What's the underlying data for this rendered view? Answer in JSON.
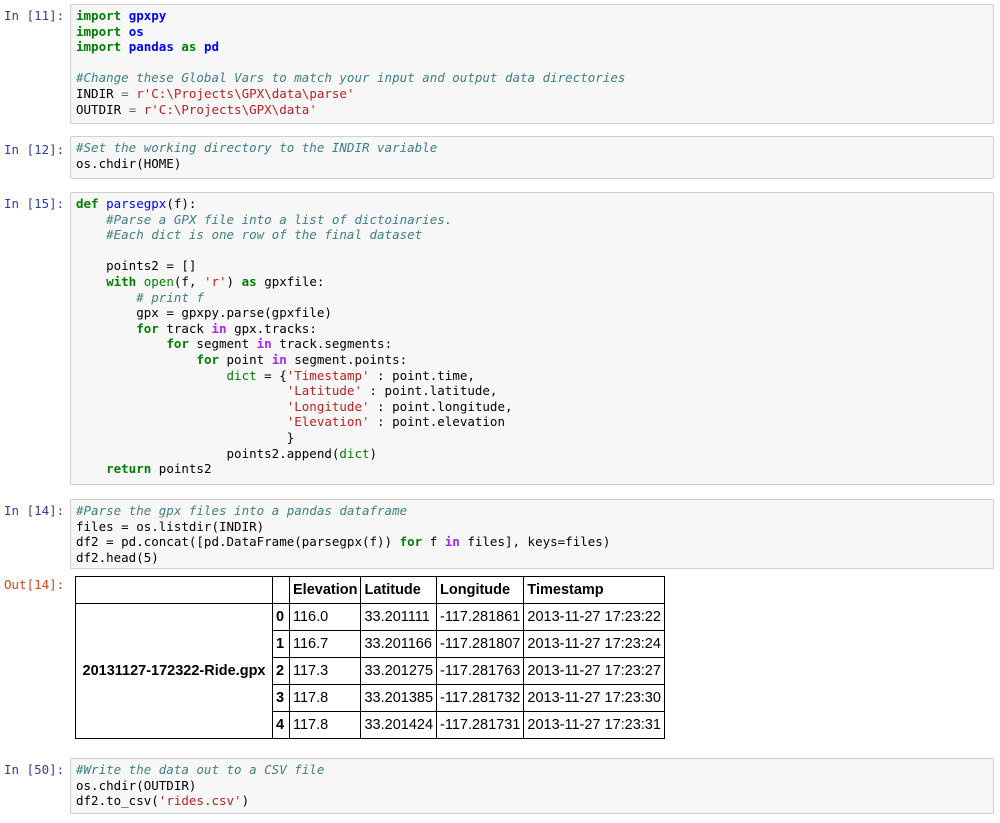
{
  "prompts": {
    "cell1": "In [11]:",
    "cell2": "In [12]:",
    "cell3": "In [15]:",
    "cell4": "In [14]:",
    "out4": "Out[14]:",
    "cell5": "In [50]:"
  },
  "cell1": {
    "kw_import": "import",
    "mod_gpxpy": "gpxpy",
    "mod_os": "os",
    "mod_pandas": "pandas",
    "kw_as": "as",
    "alias_pd": "pd",
    "comment": "#Change these Global Vars to match your input and output data directories",
    "var_indir": "INDIR",
    "var_outdir": "OUTDIR",
    "eq": "=",
    "indir_value": "r'C:\\Projects\\GPX\\data\\parse'",
    "outdir_value": "r'C:\\Projects\\GPX\\data'"
  },
  "cell2": {
    "comment": "#Set the working directory to the INDIR variable",
    "code": "os.chdir(HOME)"
  },
  "cell3": {
    "kw_def": "def",
    "fn_name": "parsegpx",
    "def_args": "(f):",
    "comment1": "#Parse a GPX file into a list of dictoinaries.",
    "comment2": "#Each dict is one row of the final dataset",
    "points_init": "points2 = []",
    "kw_with": "with",
    "open_builtin": "open",
    "open_args_a": "(f, ",
    "str_r": "'r'",
    "open_args_b": ") ",
    "kw_as": "as",
    "with_tail": " gpxfile:",
    "comment3": "# print f",
    "gpx_parse": "gpx = gpxpy.parse(gpxfile)",
    "kw_for": "for",
    "kw_in": "in",
    "loop1_var": " track ",
    "loop1_iter": " gpx.tracks:",
    "loop2_var": " segment ",
    "loop2_iter": " track.segments:",
    "loop3_var": " point ",
    "loop3_iter": " segment.points:",
    "dict_builtin": "dict",
    "dict_assign": " = {",
    "key_timestamp": "'Timestamp'",
    "val_timestamp": " : point.time,",
    "key_latitude": "'Latitude'",
    "val_latitude": " : point.latitude,",
    "key_longitude": "'Longitude'",
    "val_longitude": " : point.longitude,",
    "key_elevation": "'Elevation'",
    "val_elevation": " : point.elevation",
    "dict_close": "}",
    "append_a": "points2.append(",
    "append_b": ")",
    "kw_return": "return",
    "return_val": " points2"
  },
  "cell4": {
    "comment": "#Parse the gpx files into a pandas dataframe",
    "line2": "files = os.listdir(INDIR)",
    "line3_a": "df2 = pd.concat([pd.DataFrame(parsegpx(f)) ",
    "kw_for": "for",
    "line3_b": " f ",
    "kw_in": "in",
    "line3_c": " files], keys=files)",
    "line4": "df2.head(5)"
  },
  "dataframe": {
    "columns": [
      "Elevation",
      "Latitude",
      "Longitude",
      "Timestamp"
    ],
    "group_key": "20131127-172322-Ride.gpx",
    "rows": [
      {
        "idx": "0",
        "cells": [
          "116.0",
          "33.201111",
          "-117.281861",
          "2013-11-27 17:23:22"
        ]
      },
      {
        "idx": "1",
        "cells": [
          "116.7",
          "33.201166",
          "-117.281807",
          "2013-11-27 17:23:24"
        ]
      },
      {
        "idx": "2",
        "cells": [
          "117.3",
          "33.201275",
          "-117.281763",
          "2013-11-27 17:23:27"
        ]
      },
      {
        "idx": "3",
        "cells": [
          "117.8",
          "33.201385",
          "-117.281732",
          "2013-11-27 17:23:30"
        ]
      },
      {
        "idx": "4",
        "cells": [
          "117.8",
          "33.201424",
          "-117.281731",
          "2013-11-27 17:23:31"
        ]
      }
    ]
  },
  "cell5": {
    "comment": "#Write the data out to a CSV file",
    "line2": "os.chdir(OUTDIR)",
    "line3_a": "df2.to_csv(",
    "str_csv": "'rides.csv'",
    "line3_b": ")"
  }
}
